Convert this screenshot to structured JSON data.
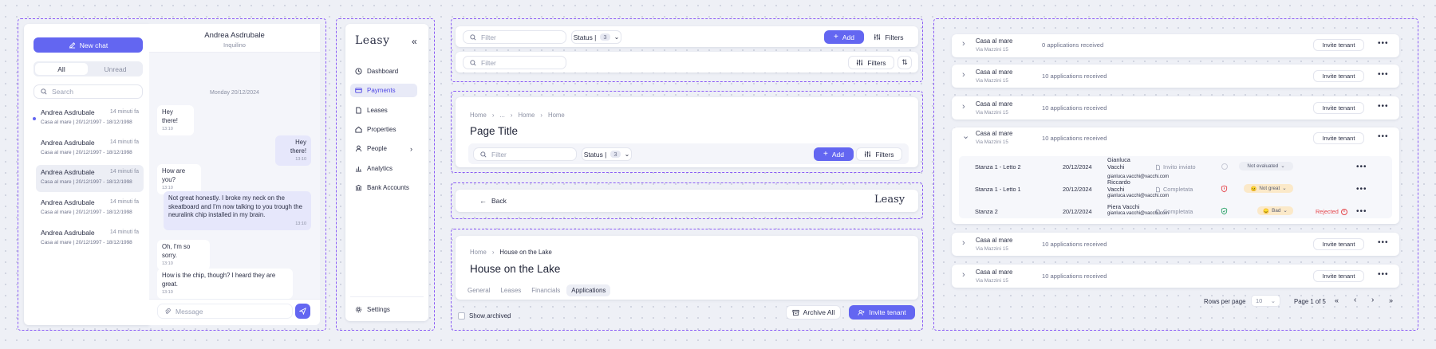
{
  "colors": {
    "accent": "#6366f1",
    "frame": "#8b5cf6",
    "danger": "#e5484d",
    "success": "#30a46c"
  },
  "chat": {
    "new_chat_label": "New chat",
    "tabs": [
      "All",
      "Unread"
    ],
    "search_placeholder": "Search",
    "conversations": [
      {
        "name": "Andrea Asdrubale",
        "time": "14 minuti fa",
        "sub": "Casa al mare | 20/12/1997 - 18/12/1998"
      },
      {
        "name": "Andrea Asdrubale",
        "time": "14 minuti fa",
        "sub": "Casa al mare | 20/12/1997 - 18/12/1998"
      },
      {
        "name": "Andrea Asdrubale",
        "time": "14 minuti fa",
        "sub": "Casa al mare | 20/12/1997 - 18/12/1998"
      },
      {
        "name": "Andrea Asdrubale",
        "time": "14 minuti fa",
        "sub": "Casa al mare | 20/12/1997 - 18/12/1998"
      },
      {
        "name": "Andrea Asdrubale",
        "time": "14 minuti fa",
        "sub": "Casa al mare | 20/12/1997 - 18/12/1998"
      }
    ],
    "header_name": "Andrea Asdrubale",
    "header_role": "Inquilino",
    "date": "Monday 20/12/2024",
    "messages": [
      {
        "text": "Hey there!",
        "time": "13:10"
      },
      {
        "text": "Hey there!",
        "time": "13:10"
      },
      {
        "text": "How are you?",
        "time": "13:10"
      },
      {
        "text": "Not great honestly. I broke my neck on the skeatboard and I'm now talking to you trough the neuralink chip installed in my brain.",
        "time": "13:10"
      },
      {
        "text": "Oh, I'm so sorry.",
        "time": "13:10"
      },
      {
        "text": "How is the chip, though? I heard they are great.",
        "time": "13:10"
      }
    ],
    "message_placeholder": "Message"
  },
  "nav": {
    "logo": "Leasy",
    "items": [
      "Dashboard",
      "Payments",
      "Leases",
      "Properties",
      "People",
      "Analytics",
      "Bank Accounts"
    ],
    "settings": "Settings"
  },
  "toolbar1": {
    "filter_placeholder": "Filter",
    "status_label": "Status |",
    "status_count": "3",
    "add_label": "Add",
    "filters_label": "Filters"
  },
  "toolbar2": {
    "filter_placeholder": "Filter",
    "filters_label": "Filters"
  },
  "page_header": {
    "crumbs": [
      "Home",
      "...",
      "Home",
      "Home"
    ],
    "title": "Page Title",
    "filter_placeholder": "Filter",
    "status_label": "Status |",
    "status_count": "3",
    "add_label": "Add",
    "filters_label": "Filters"
  },
  "back_bar": {
    "back_label": "Back",
    "logo": "Leasy"
  },
  "property": {
    "crumbs": [
      "Home",
      "House on the Lake"
    ],
    "title": "House on the Lake",
    "tabs": [
      "General",
      "Leases",
      "Financials",
      "Applications"
    ],
    "show_archived": "Show archived",
    "archive_all": "Archive All",
    "invite_tenant": "Invite tenant"
  },
  "listings": {
    "rows": [
      {
        "title": "Casa al mare",
        "sub": "Via Mazzini 15",
        "apps": "0 applications received",
        "invite": "Invite tenant"
      },
      {
        "title": "Casa al mare",
        "sub": "Via Mazzini 15",
        "apps": "10 applications received",
        "invite": "Invite tenant"
      },
      {
        "title": "Casa al mare",
        "sub": "Via Mazzini 15",
        "apps": "10 applications received",
        "invite": "Invite tenant"
      },
      {
        "title": "Casa al mare",
        "sub": "Via Mazzini 15",
        "apps": "10 applications received",
        "invite": "Invite tenant"
      },
      {
        "title": "Casa al mare",
        "sub": "Via Mazzini 15",
        "apps": "10 applications received",
        "invite": "Invite tenant"
      },
      {
        "title": "Casa al mare",
        "sub": "Via Mazzini 15",
        "apps": "10 applications received",
        "invite": "Invite tenant"
      }
    ],
    "subrows": [
      {
        "room": "Stanza 1 - Letto 2",
        "date": "20/12/2024",
        "first": "Gianluca",
        "last": "Vacchi",
        "email": "",
        "status": "Invito inviato",
        "rating": "Not evaluated",
        "decision": ""
      },
      {
        "room": "Stanza 1 - Letto 1",
        "date": "20/12/2024",
        "first": "Riccardo",
        "last": "Vacchi",
        "email": "gianluca.vacchi@vacchi.com",
        "status": "Completata",
        "rating": "Not great",
        "decision": ""
      },
      {
        "room": "Stanza 2",
        "date": "20/12/2024",
        "first": "Piera Vacchi",
        "last": "",
        "email": "gianluca.vacchi@vacchi.com",
        "status": "Completata",
        "rating": "Bad",
        "decision": "Rejected"
      }
    ],
    "extra_email": "gianluca.vacchi@vacchi.com",
    "pagination": {
      "rows_label": "Rows per page",
      "rows_value": "10",
      "page_label": "Page 1 of 5"
    }
  }
}
